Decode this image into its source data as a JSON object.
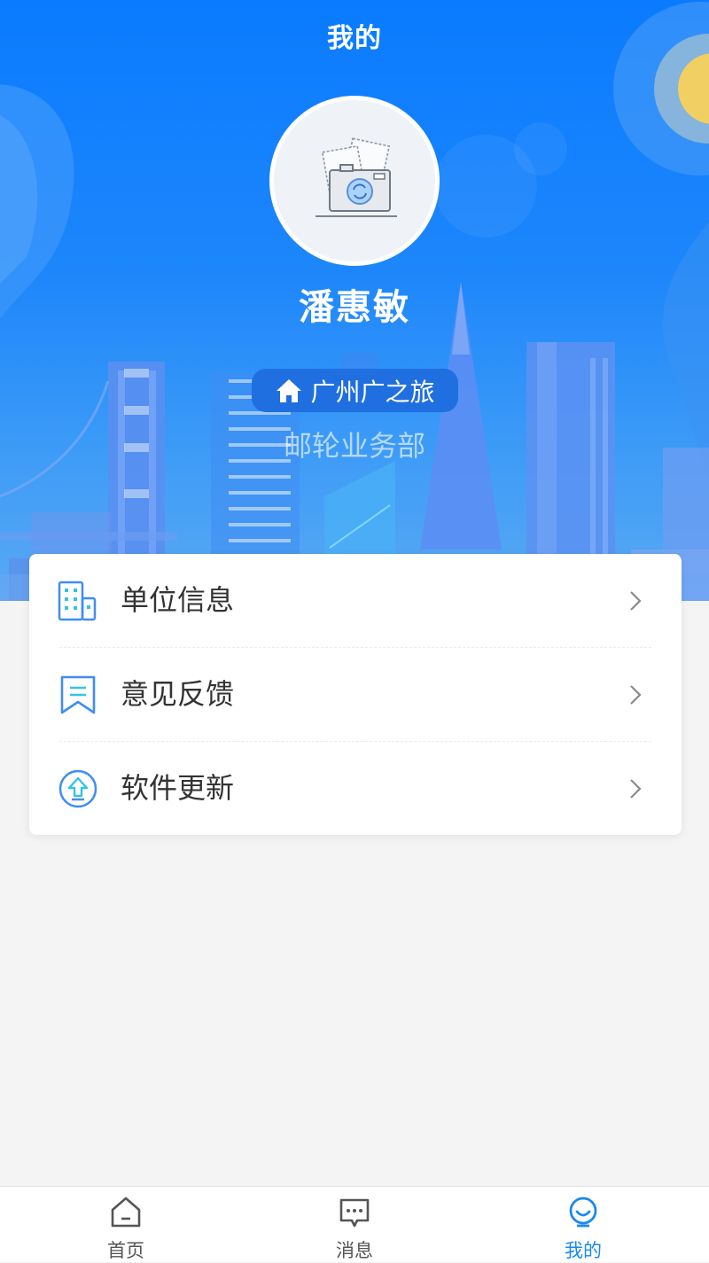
{
  "header": {
    "title": "我的"
  },
  "profile": {
    "name": "潘惠敏",
    "organization": "广州广之旅",
    "department": "邮轮业务部"
  },
  "menu": {
    "items": [
      {
        "label": "单位信息",
        "icon": "building-icon"
      },
      {
        "label": "意见反馈",
        "icon": "feedback-bookmark-icon"
      },
      {
        "label": "软件更新",
        "icon": "upload-update-icon"
      }
    ]
  },
  "tabbar": {
    "tabs": [
      {
        "label": "首页",
        "icon": "home-icon",
        "active": false
      },
      {
        "label": "消息",
        "icon": "message-icon",
        "active": false
      },
      {
        "label": "我的",
        "icon": "profile-icon",
        "active": true
      }
    ]
  },
  "colors": {
    "accent": "#1a88f0",
    "hero_top": "#0a7bff",
    "badge": "#1f6fe0",
    "text_primary": "#333333",
    "background": "#f4f4f4"
  }
}
